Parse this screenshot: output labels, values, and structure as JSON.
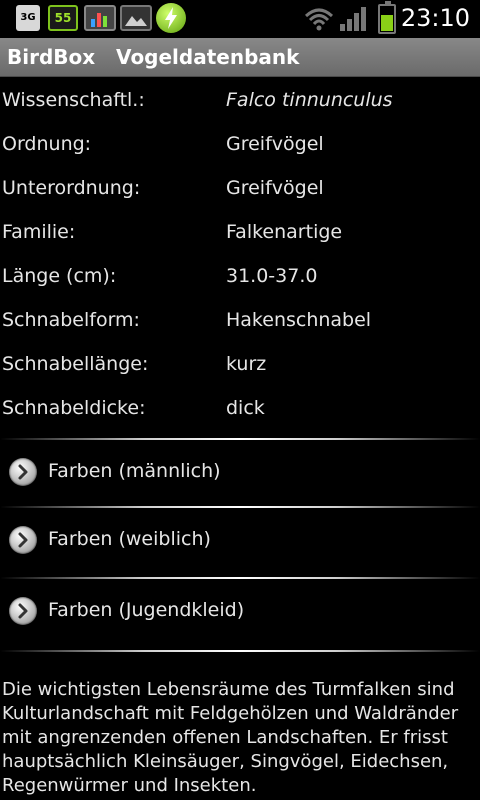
{
  "status_bar": {
    "network_label": "3G",
    "battery_percent_label": "55",
    "time": "23:10",
    "icons": [
      "3g-icon",
      "battery-percent-icon",
      "chart-icon",
      "gallery-icon",
      "bolt-icon",
      "wifi-icon",
      "signal-icon",
      "battery-icon"
    ],
    "battery_level": 0.6
  },
  "title_bar": {
    "title": "BirdBox   Vogeldatenbank"
  },
  "details": [
    {
      "label": "Wissenschaftl.:",
      "value": "Falco tinnunculus",
      "italic": true
    },
    {
      "label": "Ordnung:",
      "value": "Greifvögel"
    },
    {
      "label": "Unterordnung:",
      "value": "Greifvögel"
    },
    {
      "label": "Familie:",
      "value": "Falkenartige"
    },
    {
      "label": "Länge (cm):",
      "value": "31.0-37.0"
    },
    {
      "label": "Schnabelform:",
      "value": "Hakenschnabel"
    },
    {
      "label": "Schnabellänge:",
      "value": "kurz"
    },
    {
      "label": "Schnabeldicke:",
      "value": "dick"
    }
  ],
  "expanders": [
    {
      "label": "Farben (männlich)"
    },
    {
      "label": "Farben (weiblich)"
    },
    {
      "label": "Farben (Jugendkleid)"
    }
  ],
  "description": "Die wichtigsten Lebensräume des Turmfalken sind Kulturlandschaft mit Feldgehölzen und Waldränder mit angrenzenden offenen Landschaften. Er frisst hauptsächlich Kleinsäuger, Singvögel, Eidechsen, Regenwürmer und Insekten.",
  "colors": {
    "background": "#000000",
    "title_bar": "#7a7a7a",
    "text": "#e6e6e6",
    "battery_green": "#8ad017"
  }
}
